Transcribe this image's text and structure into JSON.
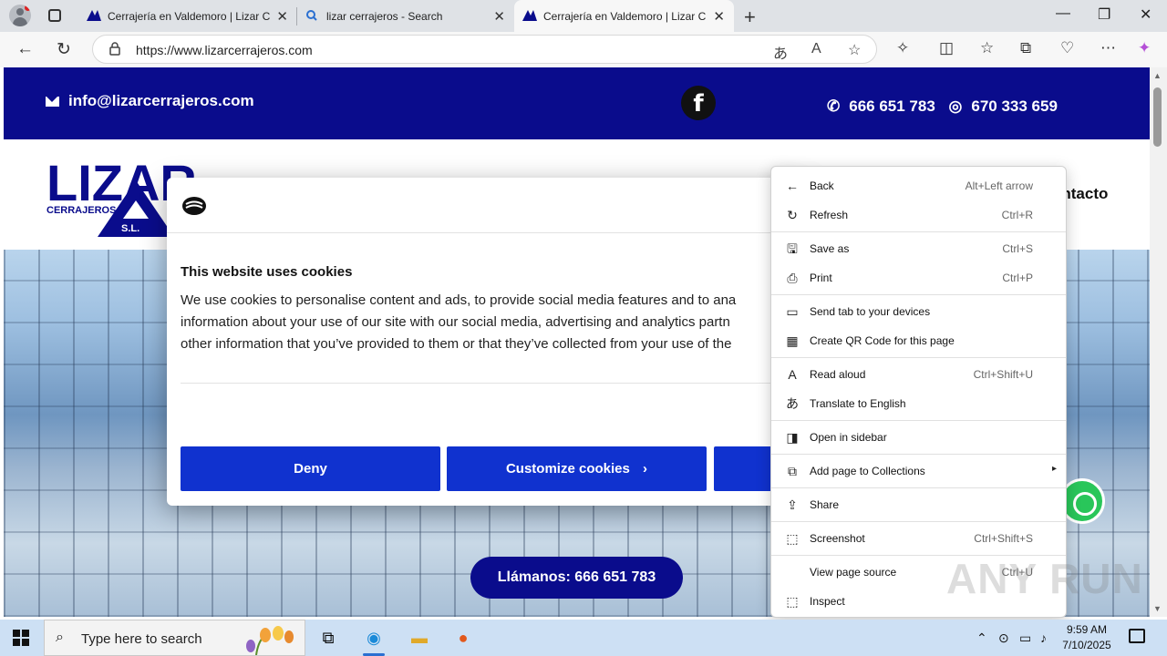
{
  "browser": {
    "tabs": [
      {
        "title": "Cerrajería en Valdemoro | Lizar Ce",
        "active": false
      },
      {
        "title": "lizar cerrajeros - Search",
        "active": false
      },
      {
        "title": "Cerrajería en Valdemoro | Lizar Ce",
        "active": true
      }
    ],
    "new_tab": "+",
    "close_glyph": "✕",
    "window_controls": {
      "minimize": "—",
      "restore": "❐",
      "close": "✕"
    },
    "url": "https://www.lizarcerrajeros.com",
    "nav": {
      "back": "←",
      "refresh": "↻"
    }
  },
  "site": {
    "email": "info@lizarcerrajeros.com",
    "facebook_glyph": "f",
    "phone1": "666 651 783",
    "phone2": "670 333 659",
    "nav_contacto": "ontacto",
    "call_button": "Llámanos: 666 651 783",
    "logo_text": {
      "main": "LIZAR",
      "sub": "CERRAJEROS",
      "suffix": "S.L."
    }
  },
  "cookie_banner": {
    "title": "This website uses cookies",
    "lines": [
      "We use cookies to personalise content and ads, to provide social media features and to ana",
      "information about your use of our site with our social media, advertising and analytics partn",
      "other information that you’ve provided to them or that they’ve collected from your use of the"
    ],
    "deny": "Deny",
    "customize": "Customize cookies",
    "customize_arrow": "›"
  },
  "context_menu": {
    "items": [
      {
        "label": "Back",
        "shortcut": "Alt+Left arrow",
        "icon": "back-arrow-icon",
        "glyph": "←"
      },
      {
        "label": "Refresh",
        "shortcut": "Ctrl+R",
        "icon": "refresh-icon",
        "glyph": "↻"
      },
      {
        "label": "Save as",
        "shortcut": "Ctrl+S",
        "icon": "save-as-icon",
        "glyph": "🖫"
      },
      {
        "label": "Print",
        "shortcut": "Ctrl+P",
        "icon": "print-icon",
        "glyph": "⎙"
      },
      {
        "label": "Send tab to your devices",
        "shortcut": "",
        "icon": "send-tab-icon",
        "glyph": "▭"
      },
      {
        "label": "Create QR Code for this page",
        "shortcut": "",
        "icon": "qr-code-icon",
        "glyph": "▦"
      },
      {
        "label": "Read aloud",
        "shortcut": "Ctrl+Shift+U",
        "icon": "read-aloud-icon",
        "glyph": "A"
      },
      {
        "label": "Translate to English",
        "shortcut": "",
        "icon": "translate-icon",
        "glyph": "あ"
      },
      {
        "label": "Open in sidebar",
        "shortcut": "",
        "icon": "sidebar-icon",
        "glyph": "◨"
      },
      {
        "label": "Add page to Collections",
        "shortcut": "",
        "icon": "collections-icon",
        "glyph": "⧉",
        "submenu": "▸"
      },
      {
        "label": "Share",
        "shortcut": "",
        "icon": "share-icon",
        "glyph": "⇪"
      },
      {
        "label": "Screenshot",
        "shortcut": "Ctrl+Shift+S",
        "icon": "screenshot-icon",
        "glyph": "⬚"
      },
      {
        "label": "View page source",
        "shortcut": "Ctrl+U",
        "icon": "",
        "glyph": ""
      },
      {
        "label": "Inspect",
        "shortcut": "",
        "icon": "inspect-icon",
        "glyph": "⬚"
      }
    ]
  },
  "watermark": "ANY RUN",
  "taskbar": {
    "search_placeholder": "Type here to search",
    "time": "9:59 AM",
    "date": "7/10/2025"
  },
  "colors": {
    "site_navy": "#0a0c8c",
    "cookie_button": "#1032cf",
    "whatsapp": "#29c65a"
  }
}
